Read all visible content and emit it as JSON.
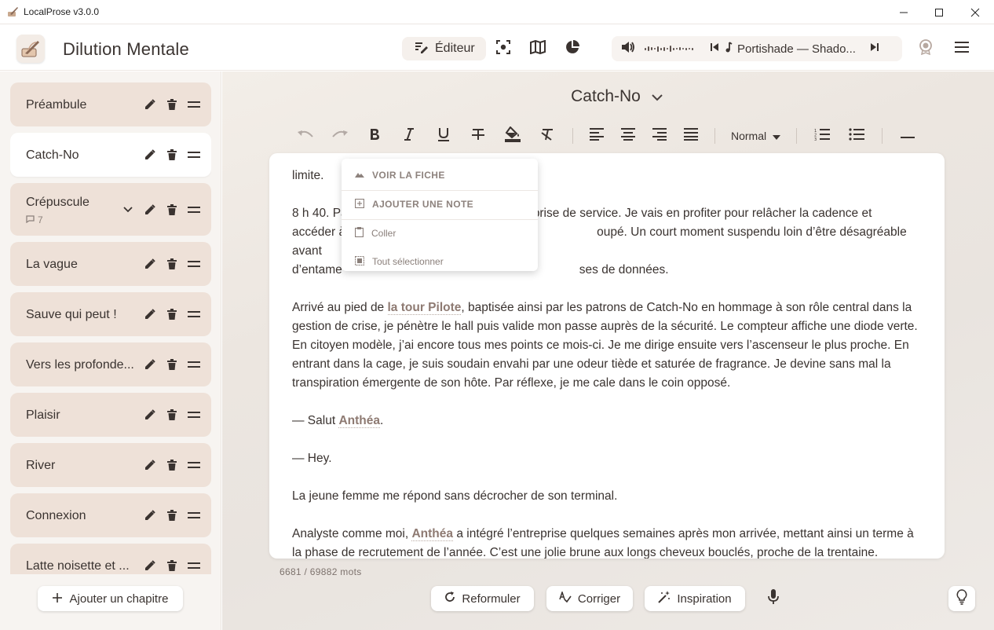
{
  "window": {
    "title": "LocalProse v3.0.0"
  },
  "header": {
    "project_title": "Dilution Mentale",
    "mode_editor_label": "Éditeur",
    "player": {
      "track": "Portishade — Shado..."
    }
  },
  "sidebar": {
    "chapters": [
      {
        "name": "Préambule"
      },
      {
        "name": "Catch-No"
      },
      {
        "name": "Crépuscule",
        "notes_count": "7"
      },
      {
        "name": "La vague"
      },
      {
        "name": "Sauve qui peut !"
      },
      {
        "name": "Vers les profonde..."
      },
      {
        "name": "Plaisir"
      },
      {
        "name": "River"
      },
      {
        "name": "Connexion"
      },
      {
        "name": "Latte noisette et ..."
      }
    ],
    "add_chapter_label": "Ajouter un chapitre"
  },
  "editor": {
    "chapter_title": "Catch-No",
    "style_select": "Normal",
    "paragraphs": {
      "p0": "limite.",
      "p1_line1": "8 h 40. Pa",
      "p1_line1_end": "nt ma prise de service. Je vais en profiter pour relâcher la cadence et",
      "p1_line2": "accéder à",
      "p1_line2_end": "oupé. Un court moment suspendu loin d’être désagréable avant",
      "p1_line3": "d’entame",
      "p1_line3_end": "ses de données.",
      "p2_a": "Arrivé au pied de ",
      "p2_entity": "la tour Pilote",
      "p2_b": ", baptisée ainsi par les patrons de Catch-No en hommage à son rôle central dans la gestion de crise, je pénètre le hall puis valide mon passe auprès de la sécurité. Le compteur affiche une diode verte. En citoyen modèle, j’ai encore tous mes points ce mois-ci. Je me dirige ensuite vers l’ascenseur le plus proche. En entrant dans la cage, je suis soudain envahi par une odeur tiède et saturée de fragrance. Je devine sans mal la transpiration émergente de son hôte. Par réflexe, je me cale dans le coin opposé.",
      "p3_a": "— Salut ",
      "p3_entity": "Anthéa",
      "p3_b": ".",
      "p4": "— Hey.",
      "p5": "La jeune femme me répond sans décrocher de son terminal.",
      "p6_a": "Analyste comme moi, ",
      "p6_entity": "Anthéa",
      "p6_b": " a intégré l’entreprise quelques semaines après mon arrivée, mettant ainsi un terme à la phase de recrutement de l’année. C’est une jolie brune aux longs cheveux bouclés, proche de la trentaine."
    },
    "word_count": "6681 / 69882 mots"
  },
  "context_menu": {
    "view_sheet": "VOIR LA FICHE",
    "add_note": "AJOUTER UNE NOTE",
    "paste": "Coller",
    "select_all": "Tout sélectionner"
  },
  "actions": {
    "reformulate": "Reformuler",
    "correct": "Corriger",
    "inspiration": "Inspiration"
  },
  "colors": {
    "sidebar_item": "#eee1d8",
    "entity_text": "#8e7a72",
    "accent": "#3a3330"
  }
}
